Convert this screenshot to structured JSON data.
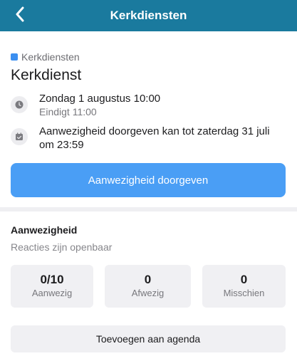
{
  "nav": {
    "title": "Kerkdiensten",
    "back_icon": "chevron-left-icon",
    "background": "#1a7a9e"
  },
  "event": {
    "category": "Kerkdiensten",
    "category_color": "#3b8ff0",
    "title": "Kerkdienst",
    "date": "Zondag 1 augustus 10:00",
    "end": "Eindigt 11:00",
    "deadline": "Aanwezigheid doorgeven kan tot zaterdag 31 juli om 23:59",
    "clock_icon": "clock-icon",
    "calendar_icon": "calendar-check-icon"
  },
  "actions": {
    "primary_label": "Aanwezigheid doorgeven",
    "primary_color": "#4a9ef5",
    "agenda_label": "Toevoegen aan agenda"
  },
  "attendance": {
    "title": "Aanwezigheid",
    "subtitle": "Reacties zijn openbaar",
    "stats": [
      {
        "value": "0/10",
        "label": "Aanwezig"
      },
      {
        "value": "0",
        "label": "Afwezig"
      },
      {
        "value": "0",
        "label": "Misschien"
      }
    ]
  }
}
